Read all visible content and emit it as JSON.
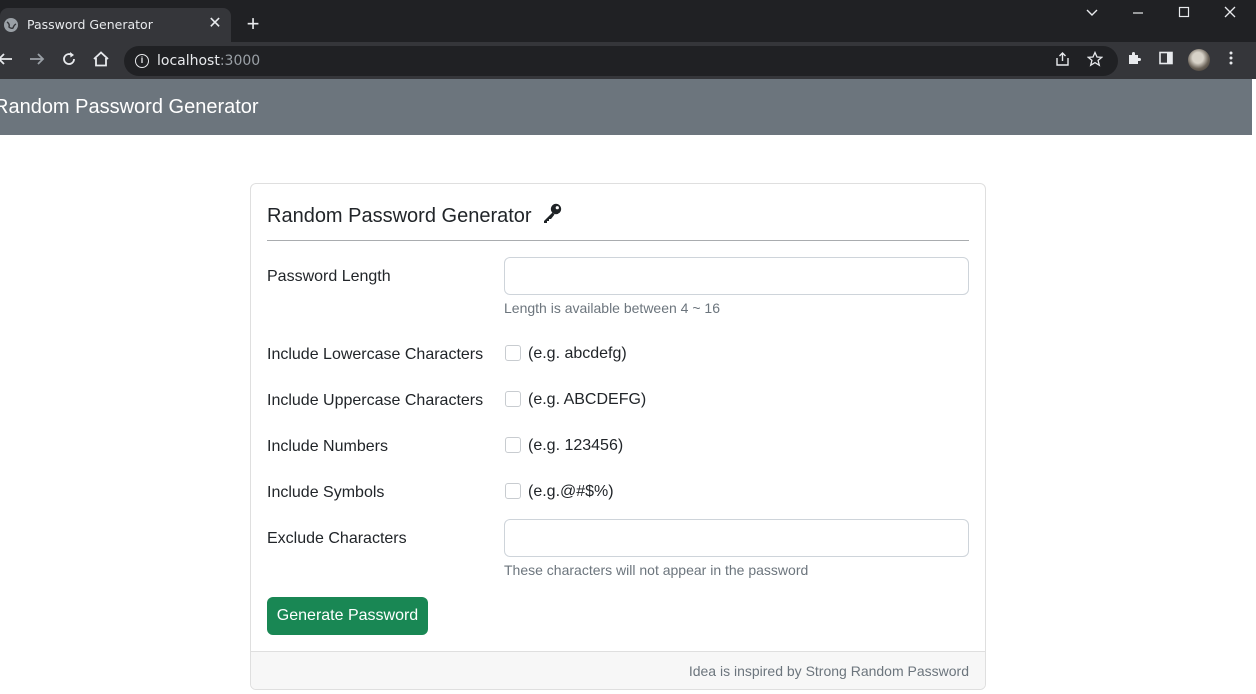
{
  "browser": {
    "tab_title": "Password Generator",
    "tab_close_icon": "close-icon",
    "new_tab_icon": "plus-icon",
    "url_host": "localhost",
    "url_port": ":3000"
  },
  "navbar": {
    "brand": "Random Password Generator"
  },
  "card": {
    "title": "Random Password Generator",
    "title_icon": "key-icon",
    "fields": {
      "length_label": "Password Length",
      "length_value": "",
      "length_help": "Length is available between 4 ~ 16",
      "lowercase_label": "Include Lowercase Characters",
      "lowercase_example": "(e.g. abcdefg)",
      "lowercase_checked": false,
      "uppercase_label": "Include Uppercase Characters",
      "uppercase_example": "(e.g. ABCDEFG)",
      "uppercase_checked": false,
      "numbers_label": "Include Numbers",
      "numbers_example": "(e.g. 123456)",
      "numbers_checked": false,
      "symbols_label": "Include Symbols",
      "symbols_example": "(e.g.@#$%)",
      "symbols_checked": false,
      "exclude_label": "Exclude Characters",
      "exclude_value": "",
      "exclude_help": "These characters will not appear in the password"
    },
    "generate_button": "Generate Password",
    "footer": "Idea is inspired by Strong Random Password"
  },
  "colors": {
    "navbar_bg": "#6c757d",
    "button_bg": "#198754",
    "browser_frame": "#202124",
    "browser_toolbar": "#35363a"
  }
}
